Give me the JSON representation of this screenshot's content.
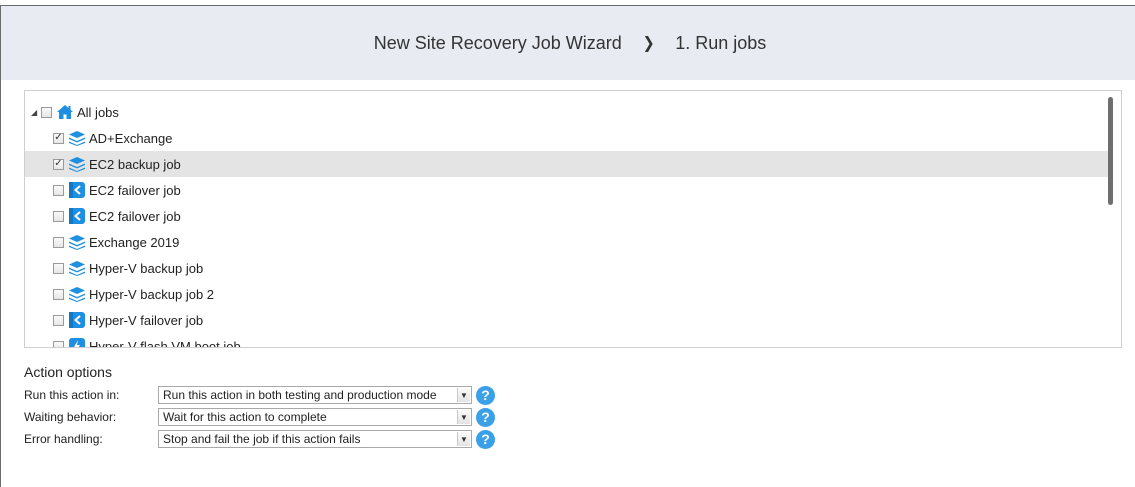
{
  "header": {
    "wizard_title": "New Site Recovery Job Wizard",
    "separator": "❯",
    "step": "1. Run jobs"
  },
  "tree": {
    "root": {
      "label": "All jobs",
      "icon": "home-icon",
      "checked": false
    },
    "items": [
      {
        "label": "AD+Exchange",
        "icon": "backup-job-icon",
        "checked": true
      },
      {
        "label": "EC2 backup job",
        "icon": "backup-job-icon",
        "checked": true,
        "selected": true
      },
      {
        "label": "EC2 failover job",
        "icon": "failover-job-icon",
        "checked": false
      },
      {
        "label": "EC2 failover job",
        "icon": "failover-job-icon",
        "checked": false
      },
      {
        "label": "Exchange 2019",
        "icon": "backup-job-icon",
        "checked": false
      },
      {
        "label": "Hyper-V backup job",
        "icon": "backup-job-icon",
        "checked": false
      },
      {
        "label": "Hyper-V backup job 2",
        "icon": "backup-job-icon",
        "checked": false
      },
      {
        "label": "Hyper-V failover job",
        "icon": "failover-job-icon",
        "checked": false
      },
      {
        "label": "Hyper-V flash VM boot job",
        "icon": "flash-boot-job-icon",
        "checked": false
      }
    ]
  },
  "action_options": {
    "title": "Action options",
    "run_in": {
      "label": "Run this action in:",
      "value": "Run this action in both testing and production mode"
    },
    "waiting": {
      "label": "Waiting behavior:",
      "value": "Wait for this action to complete"
    },
    "error": {
      "label": "Error handling:",
      "value": "Stop and fail the job if this action fails"
    },
    "help_glyph": "?"
  },
  "colors": {
    "header_bg": "#e8ebf2",
    "icon_blue": "#1e8fe1",
    "selected_row": "#e4e4e4",
    "help_blue": "#3aa0e8"
  }
}
